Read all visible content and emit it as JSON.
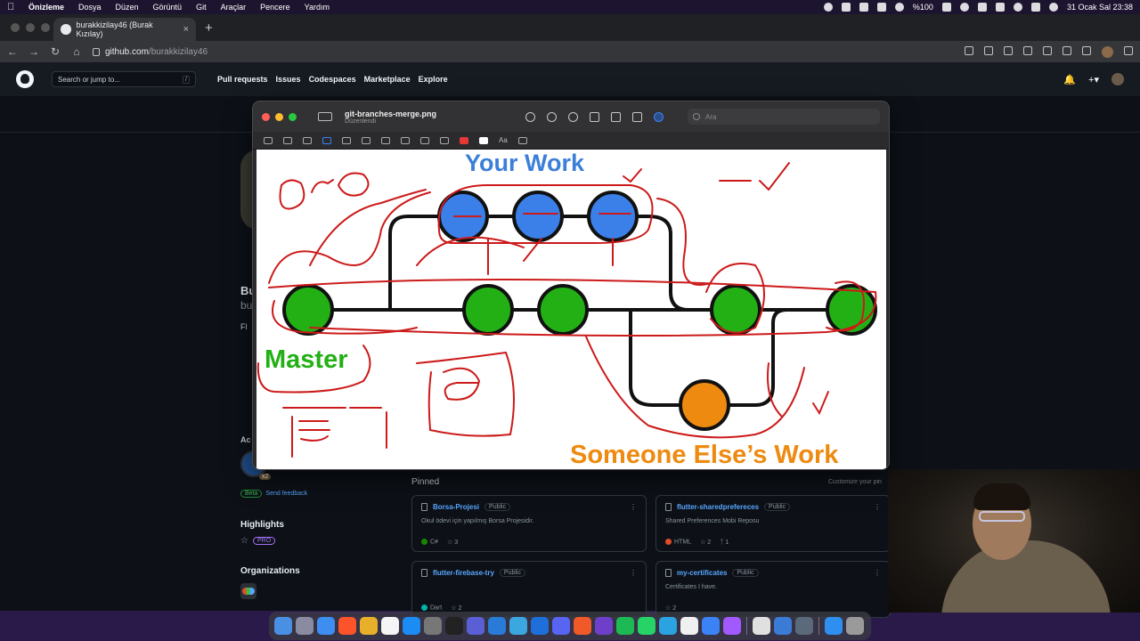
{
  "menubar": {
    "app": "Önizleme",
    "items": [
      "Dosya",
      "Düzen",
      "Görüntü",
      "Git",
      "Araçlar",
      "Pencere",
      "Yardım"
    ],
    "battery": "%100",
    "datetime": "31 Ocak Sal  23:38"
  },
  "browser": {
    "tab_title": "burakkizilay46 (Burak Kızılay)",
    "url_host": "github.com",
    "url_path": "/burakkizilay46"
  },
  "github": {
    "search_placeholder": "Search or jump to...",
    "search_key": "/",
    "nav": [
      "Pull requests",
      "Issues",
      "Codespaces",
      "Marketplace",
      "Explore"
    ],
    "profile_name_visible": "Bu",
    "profile_login_visible": "bu",
    "followers_visible": "Fl",
    "achievements_visible": "Ac",
    "achievement_count": "x2",
    "beta_label": "Beta",
    "feedback_link": "Send feedback",
    "highlights_title": "Highlights",
    "pro_badge": "PRO",
    "organizations_title": "Organizations",
    "pinned_title": "Pinned",
    "customize_visible": "Customize your pin",
    "repos": [
      {
        "name": "Borsa-Projesi",
        "visibility": "Public",
        "description": "Okul ödevi için yapılmış Borsa Projesidir.",
        "language": "C#",
        "lang_color": "#178600",
        "stars": "3",
        "forks": ""
      },
      {
        "name": "flutter-sharedprefereces",
        "visibility": "Public",
        "description": "Shared Preferences Mobi Reposu",
        "language": "HTML",
        "lang_color": "#e34c26",
        "stars": "2",
        "forks": "1"
      },
      {
        "name": "flutter-firebase-try",
        "visibility": "Public",
        "description": "",
        "language": "Dart",
        "lang_color": "#00B4AB",
        "stars": "2",
        "forks": ""
      },
      {
        "name": "my-certificates",
        "visibility": "Public",
        "description": "Certificates I have.",
        "language": "",
        "lang_color": "",
        "stars": "2",
        "forks": ""
      }
    ]
  },
  "preview": {
    "filename": "git-branches-merge.png",
    "status": "Düzenlendi",
    "search_placeholder": "Ara",
    "font_button": "Aa"
  },
  "diagram": {
    "top_label": "Your Work",
    "left_label": "Master",
    "bottom_label": "Someone Else’s Work",
    "colors": {
      "master": "#22b014",
      "your": "#3b7fe8",
      "else": "#ee8a10",
      "ink": "#cc1a1a"
    }
  }
}
